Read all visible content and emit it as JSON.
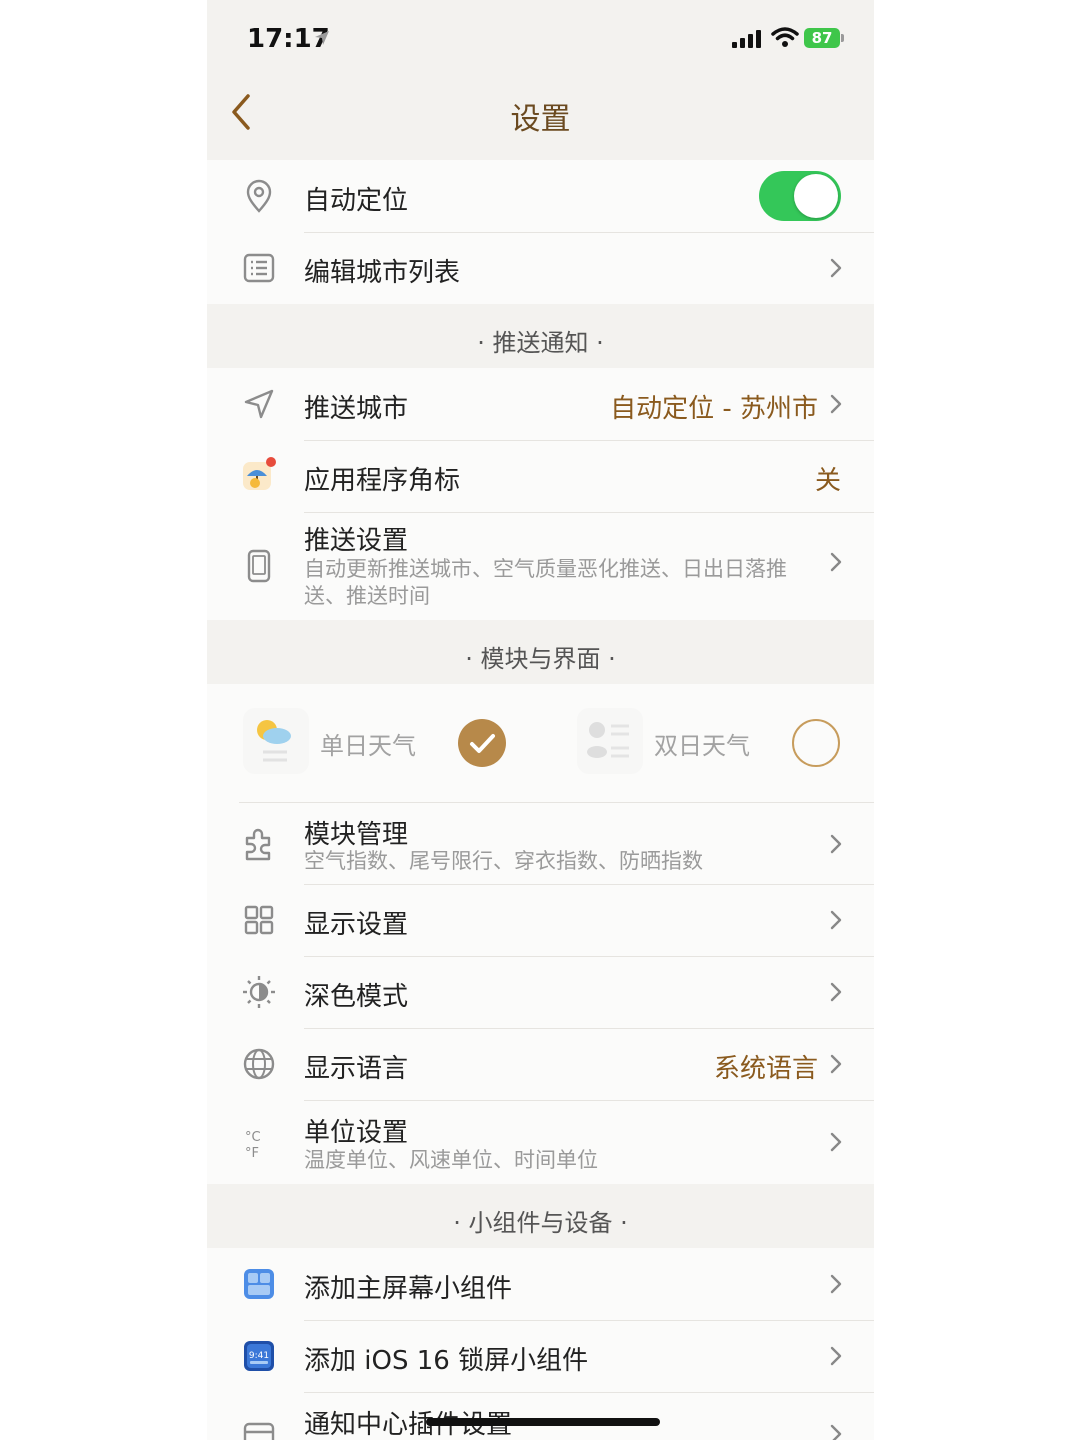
{
  "status": {
    "time": "17:17",
    "battery": "87"
  },
  "nav": {
    "title": "设置"
  },
  "location": {
    "auto_locate_label": "自动定位",
    "auto_locate_on": true,
    "edit_cities_label": "编辑城市列表"
  },
  "push": {
    "section_title": "· 推送通知 ·",
    "city_label": "推送城市",
    "city_value": "自动定位 - 苏州市",
    "badge_label": "应用程序角标",
    "badge_value": "关",
    "settings_label": "推送设置",
    "settings_sub": "自动更新推送城市、空气质量恶化推送、日出日落推送、推送时间"
  },
  "modules": {
    "section_title": "· 模块与界面 ·",
    "single_day": "单日天气",
    "single_selected": true,
    "double_day": "双日天气",
    "double_selected": false,
    "manage_label": "模块管理",
    "manage_sub": "空气指数、尾号限行、穿衣指数、防晒指数",
    "display_label": "显示设置",
    "dark_label": "深色模式",
    "language_label": "显示语言",
    "language_value": "系统语言",
    "units_label": "单位设置",
    "units_sub": "温度单位、风速单位、时间单位"
  },
  "widgets": {
    "section_title": "· 小组件与设备 ·",
    "home_widget_label": "添加主屏幕小组件",
    "lock_widget_label": "添加 iOS 16 锁屏小组件",
    "lock_icon_time": "9:41",
    "notif_label": "通知中心插件设置"
  },
  "colors": {
    "accent": "#8a5a1e",
    "toggle_on": "#34c759",
    "check": "#b7894a"
  }
}
